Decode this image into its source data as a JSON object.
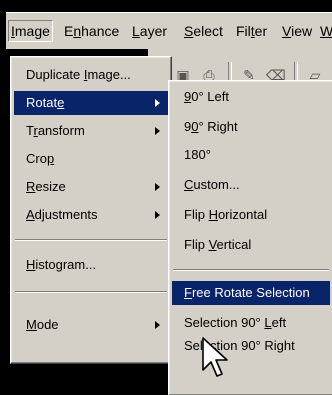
{
  "menubar": {
    "items": [
      {
        "label": "Image",
        "underline": "I",
        "rest": "mage"
      },
      {
        "label": "Enhance",
        "pre": "E",
        "underline": "n",
        "rest": "hance"
      },
      {
        "label": "Layer",
        "underline": "L",
        "rest": "ayer"
      },
      {
        "label": "Select",
        "underline": "S",
        "rest": "elect"
      },
      {
        "label": "Filter",
        "pre": "Fil",
        "underline": "t",
        "rest": "er"
      },
      {
        "label": "View",
        "underline": "V",
        "rest": "iew"
      },
      {
        "label": "W",
        "underline": "W",
        "rest": ""
      }
    ]
  },
  "image_menu": {
    "items": [
      {
        "pre": "Duplicate ",
        "u": "I",
        "post": "mage..."
      },
      {
        "pre": "Rotat",
        "u": "e",
        "post": ""
      },
      {
        "pre": "T",
        "u": "r",
        "post": "ansform"
      },
      {
        "pre": "Cro",
        "u": "p",
        "post": ""
      },
      {
        "pre": "",
        "u": "R",
        "post": "esize"
      },
      {
        "pre": "",
        "u": "A",
        "post": "djustments"
      },
      {
        "pre": "",
        "u": "H",
        "post": "istogram..."
      },
      {
        "pre": "",
        "u": "M",
        "post": "ode"
      }
    ]
  },
  "rotate_submenu": {
    "items": [
      {
        "pre": "",
        "u": "9",
        "post": "0° Left"
      },
      {
        "pre": "9",
        "u": "0",
        "post": "° Right"
      },
      {
        "pre": "180°",
        "u": "",
        "post": ""
      },
      {
        "pre": "",
        "u": "C",
        "post": "ustom..."
      },
      {
        "pre": "Flip ",
        "u": "H",
        "post": "orizontal"
      },
      {
        "pre": "Flip ",
        "u": "V",
        "post": "ertical"
      },
      {
        "pre": "",
        "u": "F",
        "post": "ree Rotate Selection"
      },
      {
        "pre": "Selection 90° ",
        "u": "L",
        "post": "eft"
      },
      {
        "pre": "Selection 90° Right",
        "u": "",
        "post": ""
      }
    ]
  },
  "colors": {
    "highlight": "#0a246a",
    "menu_bg": "#d4d0c8"
  }
}
